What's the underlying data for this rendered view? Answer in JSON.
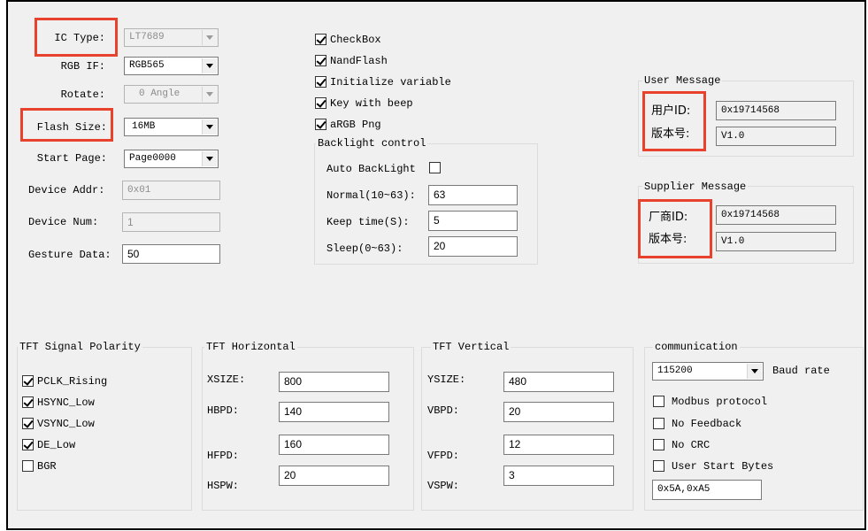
{
  "left_settings": {
    "ic_type": {
      "label": "IC Type:",
      "value": "LT7689"
    },
    "rgb_if": {
      "label": "RGB IF:",
      "value": "RGB565"
    },
    "rotate": {
      "label": "Rotate:",
      "value": "0 Angle"
    },
    "flash_size": {
      "label": "Flash Size:",
      "value": "16MB"
    },
    "start_page": {
      "label": "Start Page:",
      "value": "Page0000"
    },
    "device_addr": {
      "label": "Device Addr:",
      "value": "0x01"
    },
    "device_num": {
      "label": "Device Num:",
      "value": "1"
    },
    "gesture_data": {
      "label": "Gesture Data:",
      "value": "50"
    }
  },
  "options": [
    {
      "label": "CheckBox",
      "checked": true
    },
    {
      "label": "NandFlash",
      "checked": true
    },
    {
      "label": "Initialize variable",
      "checked": true
    },
    {
      "label": "Key with beep",
      "checked": true
    },
    {
      "label": "aRGB Png",
      "checked": true
    }
  ],
  "backlight": {
    "title": "Backlight control",
    "auto_label": "Auto BackLight",
    "auto_checked": false,
    "normal_label": "Normal(10~63):",
    "normal_value": "63",
    "keep_label": "Keep time(S):",
    "keep_value": "5",
    "sleep_label": "Sleep(0~63):",
    "sleep_value": "20"
  },
  "user_message": {
    "title": "User Message",
    "id_label": "用户ID:",
    "id_value": "0x19714568",
    "ver_label": "版本号:",
    "ver_value": "V1.0"
  },
  "supplier_message": {
    "title": "Supplier Message",
    "id_label": "厂商ID:",
    "id_value": "0x19714568",
    "ver_label": "版本号:",
    "ver_value": "V1.0"
  },
  "tft_polarity": {
    "title": "TFT Signal Polarity",
    "items": [
      {
        "label": "PCLK_Rising",
        "checked": true
      },
      {
        "label": "HSYNC_Low",
        "checked": true
      },
      {
        "label": "VSYNC_Low",
        "checked": true
      },
      {
        "label": "DE_Low",
        "checked": true
      },
      {
        "label": "BGR",
        "checked": false
      }
    ]
  },
  "tft_horizontal": {
    "title": "TFT Horizontal",
    "xsize_label": "XSIZE:",
    "xsize": "800",
    "hbpd_label": "HBPD:",
    "hbpd": "140",
    "hfpd_label": "HFPD:",
    "hfpd": "160",
    "hspw_label": "HSPW:",
    "hspw": "20"
  },
  "tft_vertical": {
    "title": "TFT Vertical",
    "ysize_label": "YSIZE:",
    "ysize": "480",
    "vbpd_label": "VBPD:",
    "vbpd": "20",
    "vfpd_label": "VFPD:",
    "vfpd": "12",
    "vspw_label": "VSPW:",
    "vspw": "3"
  },
  "communication": {
    "title": "communication",
    "baud_value": "115200",
    "baud_label": "Baud rate",
    "modbus_label": "Modbus protocol",
    "modbus_checked": false,
    "nofeedback_label": "No Feedback",
    "nofeedback_checked": false,
    "nocrc_label": "No CRC",
    "nocrc_checked": false,
    "userstart_label": "User Start Bytes",
    "userstart_checked": false,
    "start_bytes": "0x5A,0xA5"
  },
  "colors": {
    "highlight": "#e8412c",
    "panel": "#f0f0f0"
  }
}
